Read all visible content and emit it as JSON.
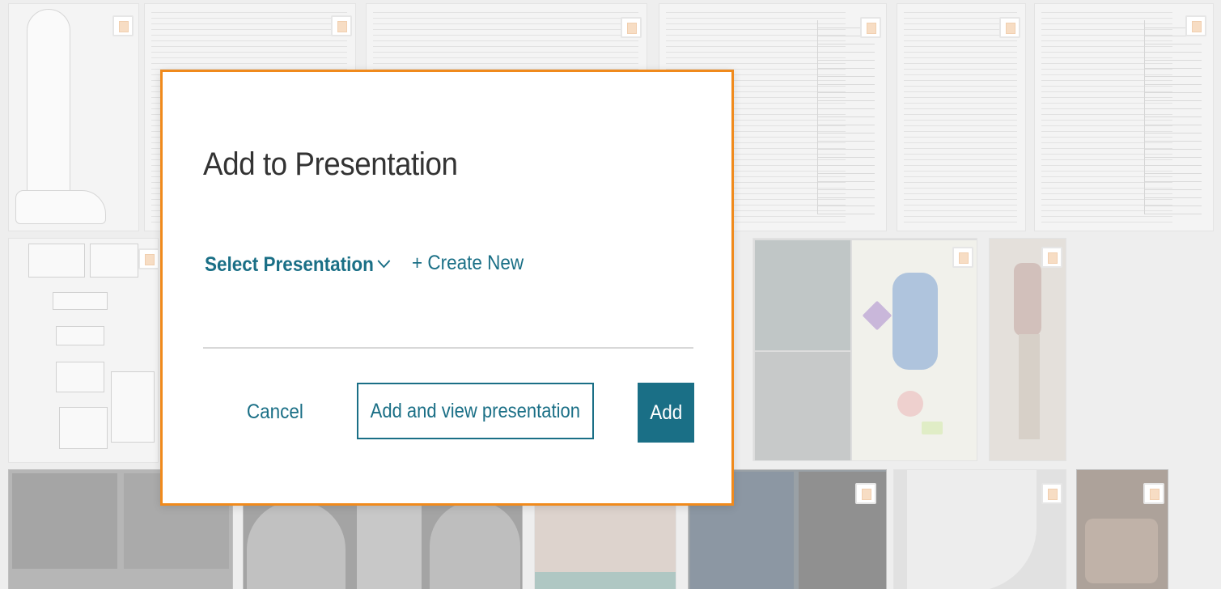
{
  "dialog": {
    "title": "Add to Presentation",
    "select_presentation_label": "Select Presentation",
    "create_new_label": "+ Create New",
    "cancel_label": "Cancel",
    "add_and_view_label": "Add and view presentation",
    "add_label": "Add"
  },
  "colors": {
    "accent": "#1a6f86",
    "dialog_border": "#f08a1c",
    "badge": "#f2c9a0"
  },
  "icons": {
    "select_dropdown": "chevron-down-icon",
    "figure_badge": "add-to-presentation-icon"
  }
}
